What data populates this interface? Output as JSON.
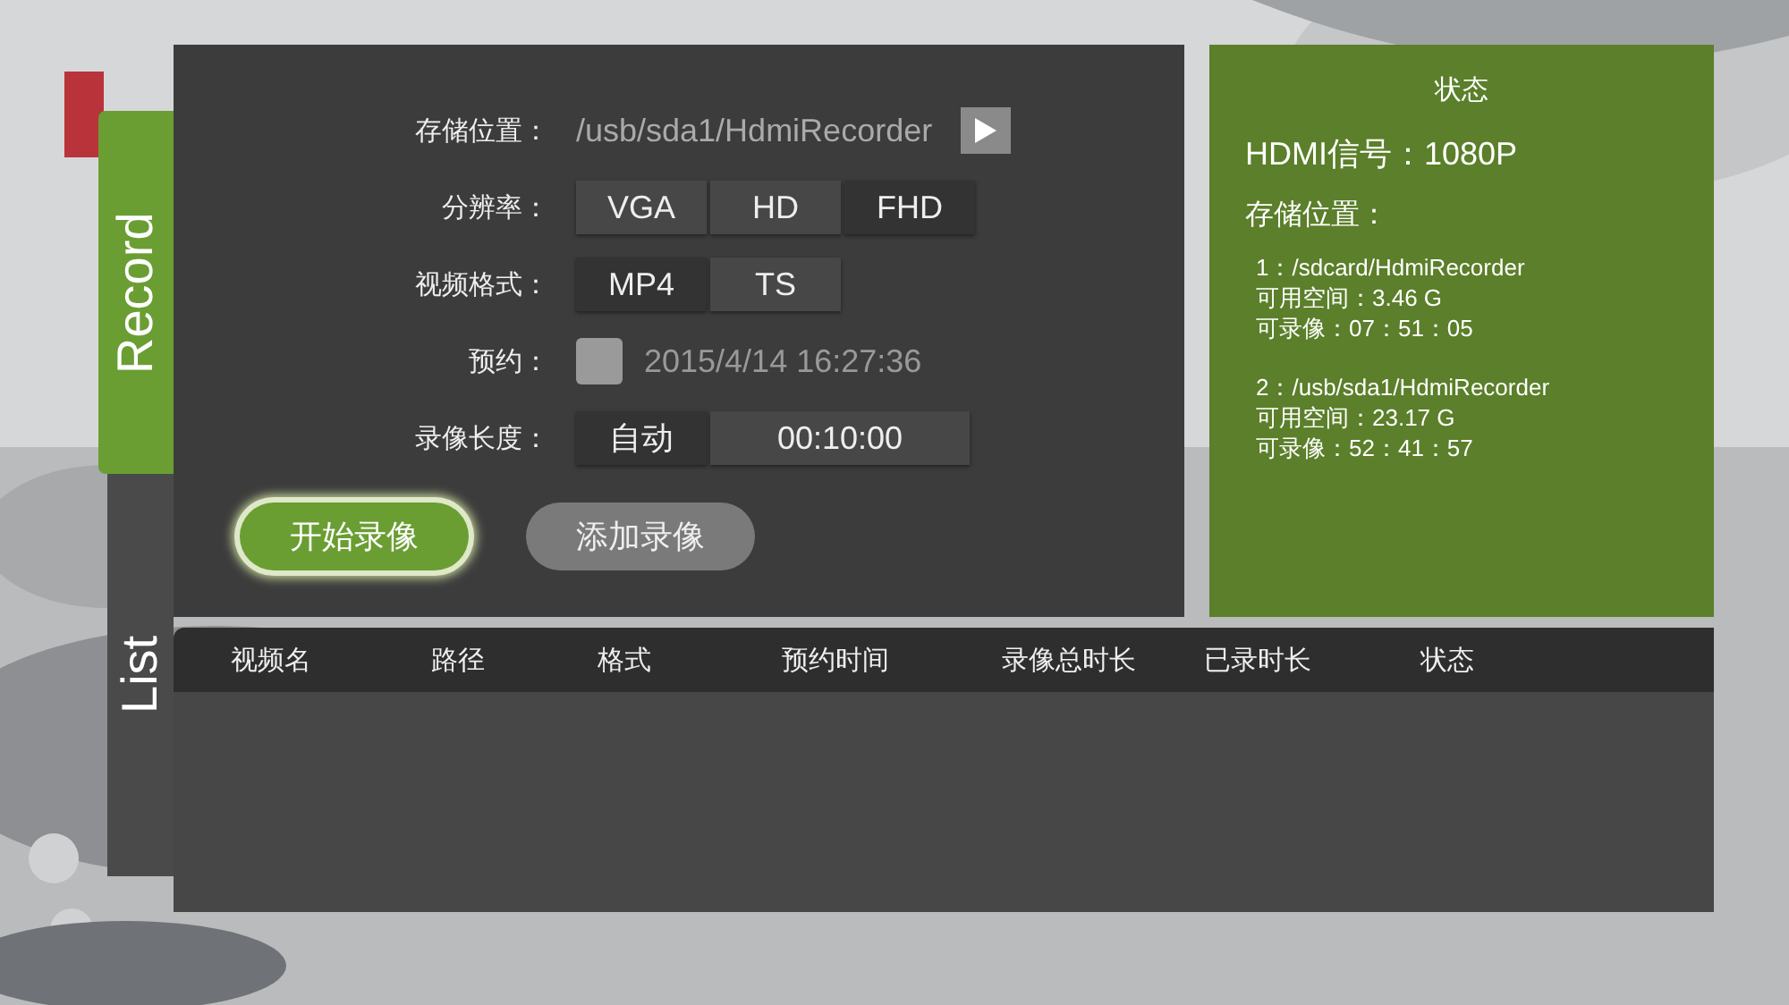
{
  "tabs": [
    {
      "label": "Record",
      "selected": true
    },
    {
      "label": "List",
      "selected": false
    }
  ],
  "record_form": {
    "storage": {
      "label": "存储位置：",
      "value": "/usb/sda1/HdmiRecorder"
    },
    "resolution": {
      "label": "分辨率：",
      "options": [
        {
          "label": "VGA",
          "selected": false
        },
        {
          "label": "HD",
          "selected": false
        },
        {
          "label": "FHD",
          "selected": true
        }
      ]
    },
    "video_format": {
      "label": "视频格式：",
      "options": [
        {
          "label": "MP4",
          "selected": true
        },
        {
          "label": "TS",
          "selected": false
        }
      ]
    },
    "schedule": {
      "label": "预约：",
      "checked": false,
      "value": "2015/4/14 16:27:36"
    },
    "duration": {
      "label": "录像长度：",
      "options": [
        {
          "label": "自动",
          "selected": true
        },
        {
          "label": "00:10:00",
          "selected": false
        }
      ]
    },
    "buttons": [
      {
        "label": "开始录像",
        "focused": true
      },
      {
        "label": "添加录像",
        "focused": false
      }
    ]
  },
  "status_panel": {
    "title": "状态",
    "hdmi_signal": "HDMI信号：1080P",
    "storage_heading": "存储位置：",
    "locations": [
      {
        "path": "1：/sdcard/HdmiRecorder",
        "free_space": "可用空间：3.46 G",
        "record_time": "可录像：07：51：05"
      },
      {
        "path": "2：/usb/sda1/HdmiRecorder",
        "free_space": "可用空间：23.17 G",
        "record_time": "可录像：52：41：57"
      }
    ]
  },
  "table": {
    "columns": [
      "视频名",
      "路径",
      "格式",
      "预约时间",
      "录像总时长",
      "已录时长",
      "状态"
    ]
  }
}
